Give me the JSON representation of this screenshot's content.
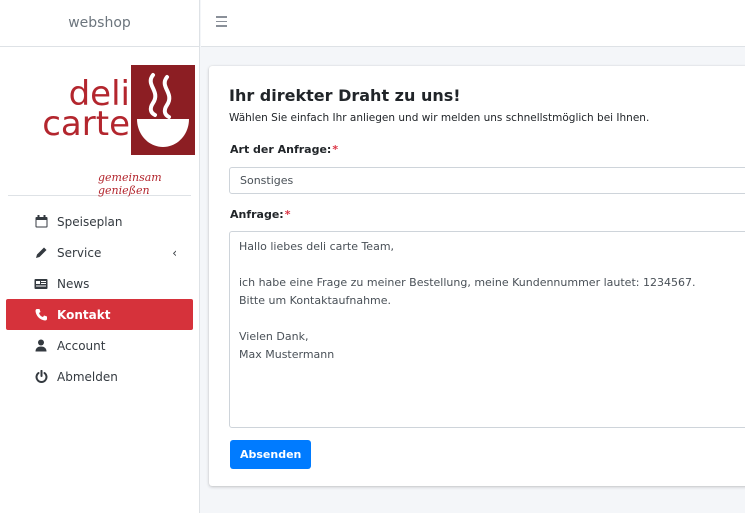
{
  "brand": {
    "title": "webshop"
  },
  "logo": {
    "line1": "deli",
    "line2": "carte",
    "tagline": "gemeinsam genießen",
    "color": "#b3262e"
  },
  "sidebar": {
    "items": [
      {
        "label": "Speiseplan",
        "icon": "calendar-icon"
      },
      {
        "label": "Service",
        "icon": "pencil-icon",
        "chevron": "‹"
      },
      {
        "label": "News",
        "icon": "newspaper-icon"
      },
      {
        "label": "Kontakt",
        "icon": "phone-icon",
        "active": true
      },
      {
        "label": "Account",
        "icon": "user-icon"
      },
      {
        "label": "Abmelden",
        "icon": "power-icon"
      }
    ]
  },
  "form": {
    "title": "Ihr direkter Draht zu uns!",
    "subtitle": "Wählen Sie einfach Ihr anliegen und wir melden uns schnellstmöglich bei Ihnen.",
    "type_label": "Art der Anfrage:",
    "type_value": "Sonstiges",
    "message_label": "Anfrage:",
    "message_value": "Hallo liebes deli carte Team,\n\nich habe eine Frage zu meiner Bestellung, meine Kundennummer lautet: 1234567.\nBitte um Kontaktaufnahme.\n\nVielen Dank,\nMax Mustermann",
    "required_marker": "*",
    "submit_label": "Absenden"
  },
  "colors": {
    "accent": "#d6323b",
    "primary": "#007bff",
    "required": "#dc3545"
  }
}
